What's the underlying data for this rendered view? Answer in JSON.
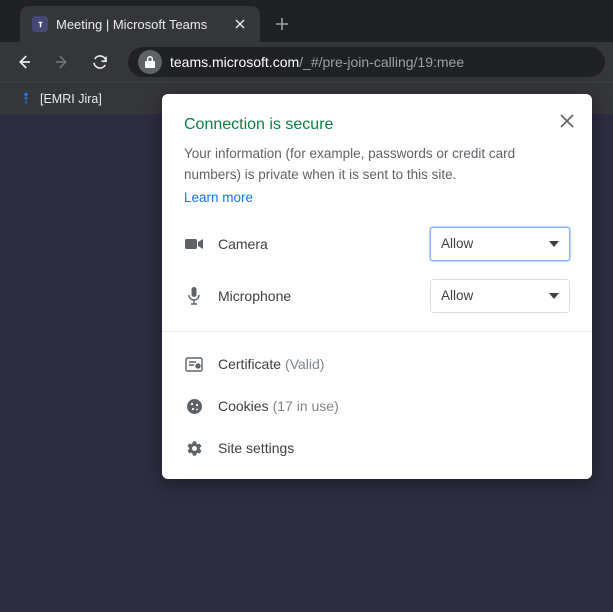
{
  "tab": {
    "title": "Meeting | Microsoft Teams"
  },
  "url": {
    "host": "teams.microsoft.com",
    "path": "/_#/pre-join-calling/19:mee"
  },
  "bookmarks": {
    "items": [
      {
        "label": "[EMRI Jira]"
      }
    ]
  },
  "popover": {
    "title": "Connection is secure",
    "desc": "Your information (for example, passwords or credit card numbers) is private when it is sent to this site.",
    "learn_more": "Learn more",
    "permissions": [
      {
        "label": "Camera",
        "value": "Allow"
      },
      {
        "label": "Microphone",
        "value": "Allow"
      }
    ],
    "info": {
      "certificate_label": "Certificate",
      "certificate_status": "(Valid)",
      "cookies_label": "Cookies",
      "cookies_status": "(17 in use)",
      "settings_label": "Site settings"
    }
  }
}
